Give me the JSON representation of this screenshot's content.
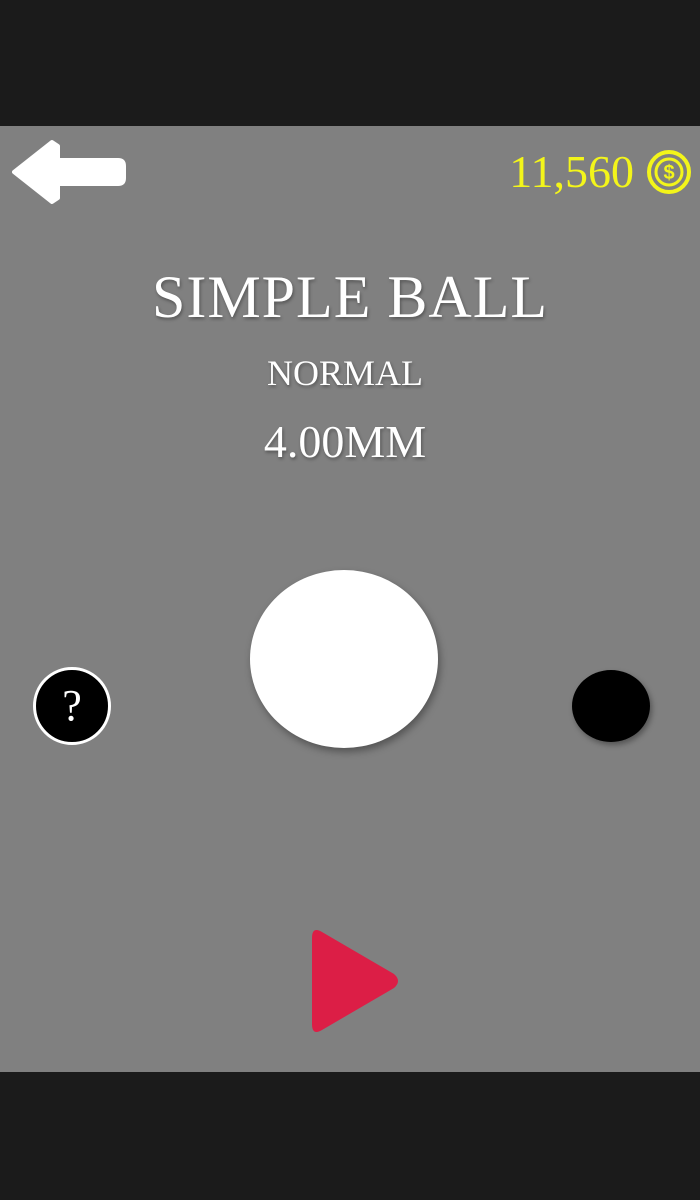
{
  "header": {
    "back_icon": "arrow-left-icon",
    "coins": "11,560",
    "coin_icon": "dollar-coin-icon",
    "coin_color": "#f3f51a"
  },
  "ball": {
    "name": "SIMPLE BALL",
    "type": "NORMAL",
    "size": "4.00MM",
    "color": "#ffffff"
  },
  "controls": {
    "help_label": "?",
    "next_ball_color": "#000000",
    "play_icon": "play-icon",
    "play_color": "#dc1e46"
  },
  "colors": {
    "background": "#808080",
    "bars": "#1b1b1b"
  }
}
